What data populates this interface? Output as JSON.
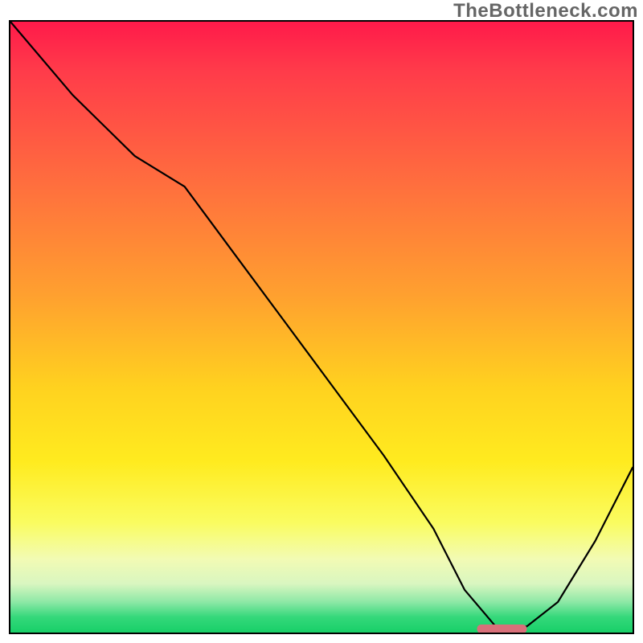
{
  "watermark": "TheBottleneck.com",
  "chart_data": {
    "type": "line",
    "title": "",
    "xlabel": "",
    "ylabel": "",
    "xlim": [
      0,
      100
    ],
    "ylim": [
      0,
      100
    ],
    "grid": false,
    "series": [
      {
        "name": "bottleneck-curve",
        "x": [
          0,
          10,
          20,
          28,
          36,
          44,
          52,
          60,
          68,
          73,
          78,
          83,
          88,
          94,
          100
        ],
        "y": [
          100,
          88,
          78,
          73,
          62,
          51,
          40,
          29,
          17,
          7,
          1,
          1,
          5,
          15,
          27
        ]
      }
    ],
    "annotations": [
      {
        "name": "optimal-marker",
        "type": "bar",
        "x_start": 75,
        "x_end": 83,
        "y": 0.5,
        "color": "#d9707a"
      }
    ],
    "background": {
      "type": "vertical-gradient",
      "stops": [
        {
          "pct": 0,
          "color": "#ff1a4a"
        },
        {
          "pct": 45,
          "color": "#ffa12f"
        },
        {
          "pct": 72,
          "color": "#ffeb1f"
        },
        {
          "pct": 92,
          "color": "#d9f6c0"
        },
        {
          "pct": 100,
          "color": "#18cf68"
        }
      ]
    }
  }
}
